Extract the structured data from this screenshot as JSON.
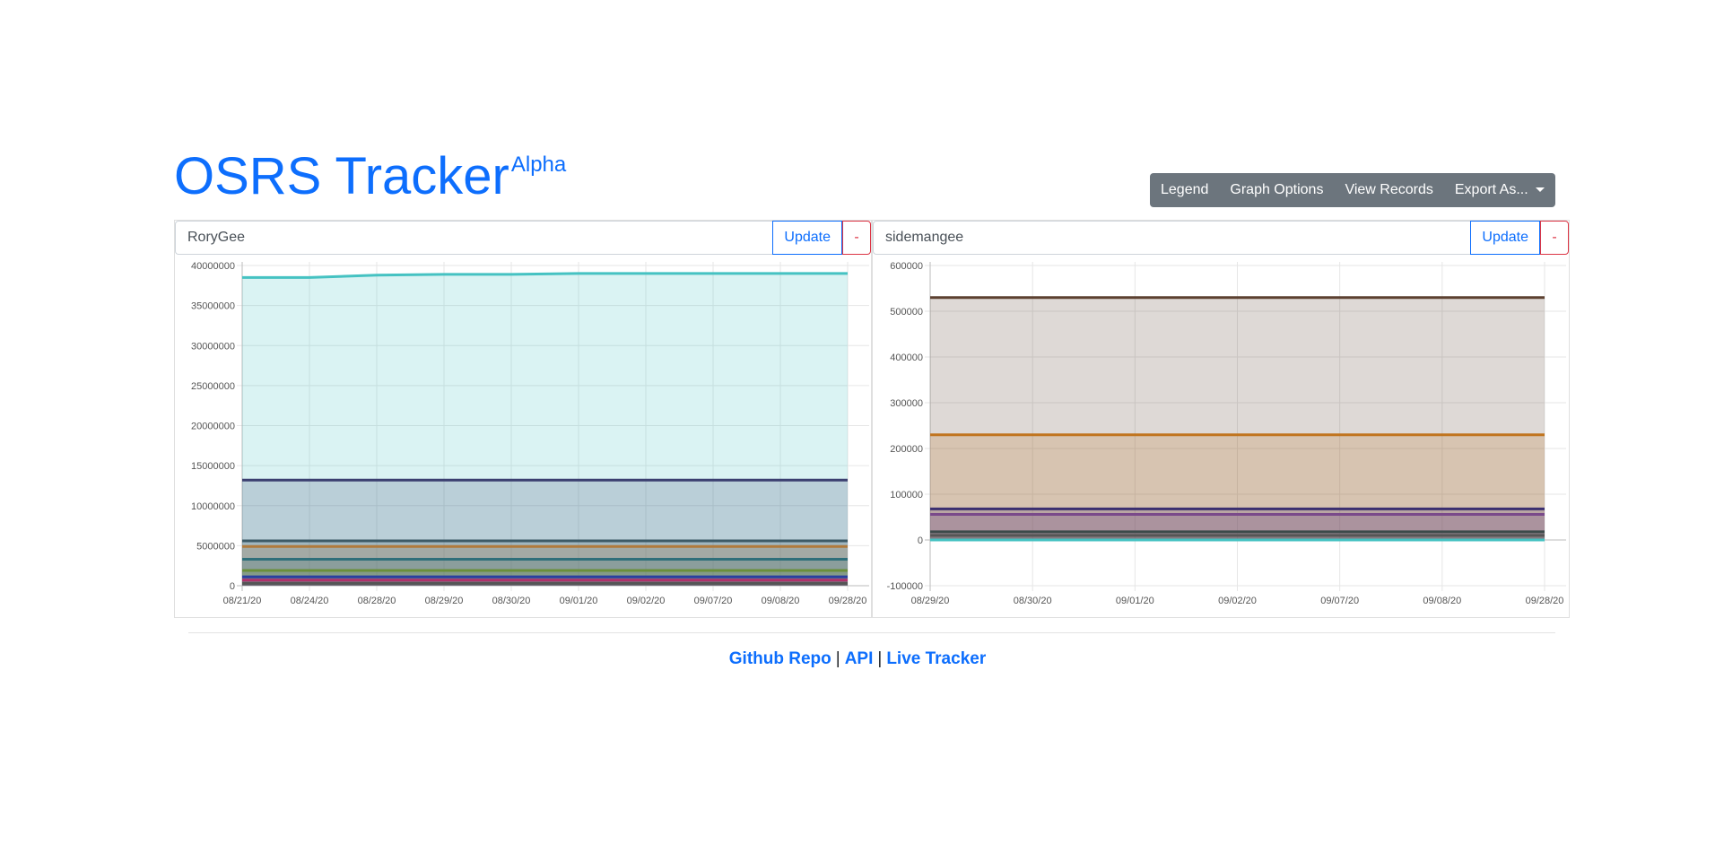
{
  "header": {
    "title": "OSRS Tracker",
    "badge": "Alpha",
    "buttons": {
      "legend": "Legend",
      "graph_options": "Graph Options",
      "view_records": "View Records",
      "export": "Export As..."
    }
  },
  "panels": [
    {
      "username": "RoryGee",
      "update_label": "Update",
      "remove_label": "-"
    },
    {
      "username": "sidemangee",
      "update_label": "Update",
      "remove_label": "-"
    }
  ],
  "footer": {
    "github": "Github Repo",
    "api": "API",
    "live": "Live Tracker",
    "separator": "|"
  },
  "chart_data": [
    {
      "type": "area",
      "categories": [
        "08/21/20",
        "08/24/20",
        "08/28/20",
        "08/29/20",
        "08/30/20",
        "09/01/20",
        "09/02/20",
        "09/07/20",
        "09/08/20",
        "09/28/20"
      ],
      "yticks": [
        0,
        5000000,
        10000000,
        15000000,
        20000000,
        25000000,
        30000000,
        35000000,
        40000000
      ],
      "ylim": [
        0,
        40000000
      ],
      "grid": true,
      "series": [
        {
          "color": "#45c2c2",
          "values": [
            38500000,
            38500000,
            38800000,
            38900000,
            38900000,
            39000000,
            39000000,
            39000000,
            39000000,
            39000000
          ]
        },
        {
          "color": "#3b3f70",
          "values": [
            13200000,
            13200000,
            13200000,
            13200000,
            13200000,
            13200000,
            13200000,
            13200000,
            13200000,
            13200000
          ]
        },
        {
          "color": "#3c5a66",
          "values": [
            5600000,
            5600000,
            5600000,
            5600000,
            5600000,
            5600000,
            5600000,
            5600000,
            5600000,
            5600000
          ]
        },
        {
          "color": "#b07a3c",
          "values": [
            4900000,
            4900000,
            4900000,
            4900000,
            4900000,
            4900000,
            4900000,
            4900000,
            4900000,
            4900000
          ]
        },
        {
          "color": "#2f6f7a",
          "values": [
            3300000,
            3300000,
            3300000,
            3300000,
            3300000,
            3300000,
            3300000,
            3300000,
            3300000,
            3300000
          ]
        },
        {
          "color": "#6a8f3a",
          "values": [
            1900000,
            1900000,
            1900000,
            1900000,
            1900000,
            1900000,
            1900000,
            1900000,
            1900000,
            1900000
          ]
        },
        {
          "color": "#2a3fa0",
          "values": [
            1100000,
            1100000,
            1100000,
            1100000,
            1100000,
            1100000,
            1100000,
            1100000,
            1100000,
            1100000
          ]
        },
        {
          "color": "#b0306a",
          "values": [
            700000,
            700000,
            700000,
            700000,
            700000,
            700000,
            700000,
            700000,
            700000,
            700000
          ]
        },
        {
          "color": "#555555",
          "values": [
            300000,
            300000,
            300000,
            300000,
            300000,
            300000,
            300000,
            300000,
            300000,
            300000
          ]
        }
      ]
    },
    {
      "type": "area",
      "categories": [
        "08/29/20",
        "08/30/20",
        "09/01/20",
        "09/02/20",
        "09/07/20",
        "09/08/20",
        "09/28/20"
      ],
      "yticks": [
        -100000,
        0,
        100000,
        200000,
        300000,
        400000,
        500000,
        600000
      ],
      "ylim": [
        -100000,
        600000
      ],
      "grid": true,
      "series": [
        {
          "color": "#5c4030",
          "values": [
            530000,
            530000,
            530000,
            530000,
            530000,
            530000,
            530000
          ]
        },
        {
          "color": "#c0741e",
          "values": [
            230000,
            230000,
            230000,
            230000,
            230000,
            230000,
            230000
          ]
        },
        {
          "color": "#3b2f70",
          "values": [
            68000,
            68000,
            68000,
            68000,
            68000,
            68000,
            68000
          ]
        },
        {
          "color": "#7a4a8a",
          "values": [
            56000,
            56000,
            56000,
            56000,
            56000,
            56000,
            56000
          ]
        },
        {
          "color": "#3c4a4a",
          "values": [
            18000,
            18000,
            18000,
            18000,
            18000,
            18000,
            18000
          ]
        },
        {
          "color": "#555555",
          "values": [
            10000,
            10000,
            10000,
            10000,
            10000,
            10000,
            10000
          ]
        },
        {
          "color": "#45c2c2",
          "values": [
            0,
            0,
            0,
            0,
            0,
            0,
            0
          ]
        }
      ]
    }
  ]
}
